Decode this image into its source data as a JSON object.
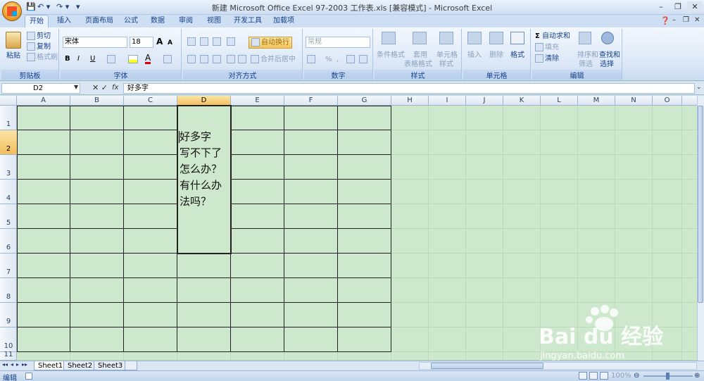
{
  "window": {
    "title": "新建 Microsoft Office Excel 97-2003 工作表.xls  [兼容模式] - Microsoft Excel",
    "qat_symbols": [
      "💾",
      "↶ ▾",
      "↷ ▾",
      "▾"
    ],
    "controls": [
      "–",
      "❐",
      "✕"
    ],
    "ribbon_controls": [
      "–",
      "❐",
      "✕"
    ],
    "help": "❓"
  },
  "tabs": [
    "开始",
    "插入",
    "页面布局",
    "公式",
    "数据",
    "审阅",
    "视图",
    "开发工具",
    "加载项"
  ],
  "ribbon": {
    "clipboard": {
      "label": "剪贴板",
      "paste": "粘贴",
      "cut": "剪切",
      "copy": "复制",
      "format_painter": "格式刷"
    },
    "font": {
      "label": "字体",
      "font_name": "宋体",
      "font_size": "18",
      "bold": "B",
      "italic": "I",
      "underline": "U",
      "grow": "A",
      "shrink": "A"
    },
    "alignment": {
      "label": "对齐方式",
      "wrap_text": "自动换行",
      "merge_center": "合并后居中"
    },
    "number": {
      "label": "数字",
      "format": "常规",
      "percent": "%",
      "comma": ","
    },
    "styles": {
      "label": "样式",
      "conditional": "条件格式",
      "table_format_1": "套用",
      "table_format_2": "表格格式",
      "cell_styles_1": "单元格",
      "cell_styles_2": "样式"
    },
    "cells": {
      "label": "单元格",
      "insert": "插入",
      "delete": "删除",
      "format": "格式"
    },
    "editing": {
      "label": "编辑",
      "autosum": "自动求和",
      "fill": "填充",
      "clear": "清除",
      "sort_1": "排序和",
      "sort_2": "筛选",
      "find_1": "查找和",
      "find_2": "选择"
    }
  },
  "formula_bar": {
    "name_box": "D2",
    "fx": "fx",
    "buttons": "✕ ✓",
    "content": "好多字"
  },
  "columns": [
    "A",
    "B",
    "C",
    "D",
    "E",
    "F",
    "G",
    "H",
    "I",
    "J",
    "K",
    "L",
    "M",
    "N",
    "O"
  ],
  "rows": [
    "1",
    "2",
    "3",
    "4",
    "5",
    "6",
    "7",
    "8",
    "9",
    "10",
    "11"
  ],
  "active_cell": {
    "ref": "D2",
    "text": "好多字\n写不下了\n怎么办？\n有什么办\n法吗？"
  },
  "sheets": [
    "Sheet1",
    "Sheet2",
    "Sheet3"
  ],
  "sheet_nav": [
    "◂◂",
    "◂",
    "▸",
    "▸▸"
  ],
  "status": {
    "mode": "编辑",
    "zoom": "100%"
  },
  "watermark": {
    "brand": "Bai du 经验",
    "url": "jingyan.baidu.com"
  },
  "colors": {
    "sheet_bg": "#cde8cd",
    "ribbon": "#dbe7f6",
    "accent": "#f2be5a"
  }
}
